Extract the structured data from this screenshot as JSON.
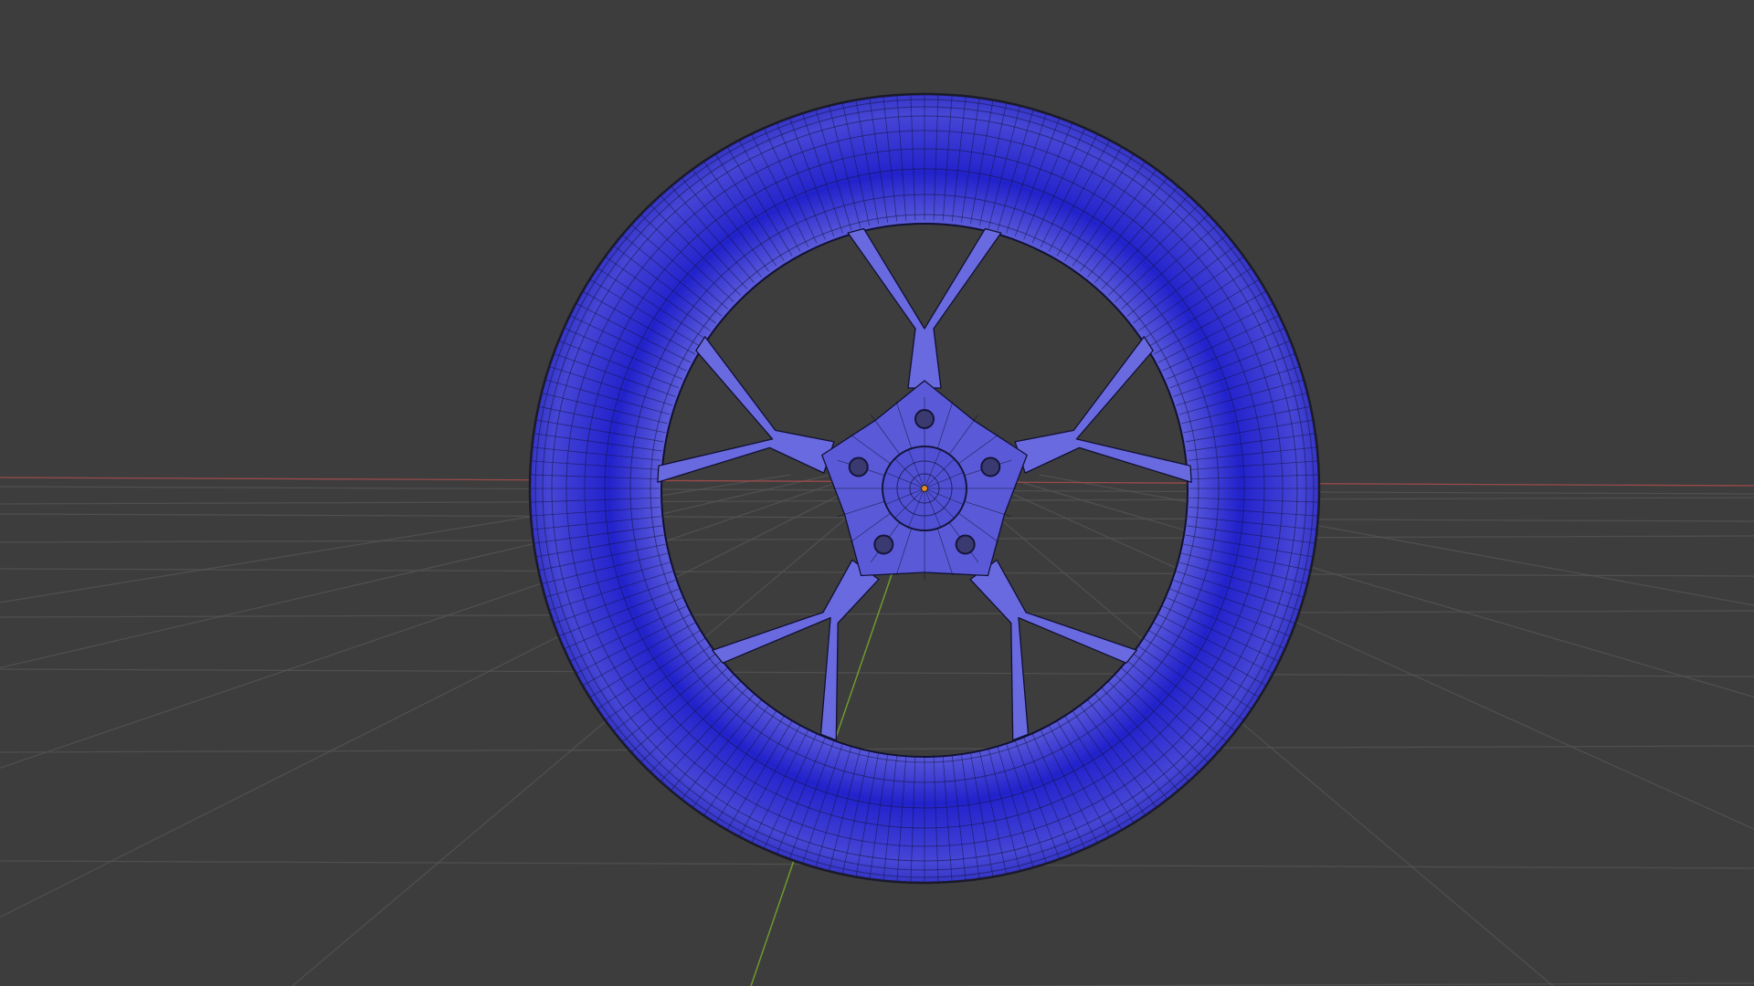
{
  "viewport": {
    "mode": "3d-viewport",
    "background_color": "#3d3d3d",
    "grid_color": "#555555",
    "x_axis_color": "#9a4a4a",
    "y_axis_color": "#6e9a2e"
  },
  "object": {
    "name": "wheel-rim",
    "display": "mesh-with-wireframe",
    "fill_color": "#2222cc",
    "face_tint_color": "#5a5ad8",
    "edge_color": "#111133",
    "origin_color": "#e08a2a",
    "lug_holes": 5,
    "spokes": 10
  }
}
